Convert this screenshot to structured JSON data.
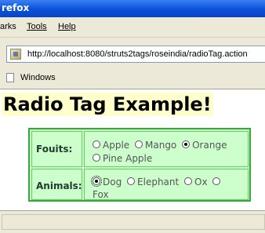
{
  "window": {
    "title": "refox"
  },
  "menubar": {
    "items": [
      {
        "label": "arks"
      },
      {
        "label": "Tools",
        "underline": "T"
      },
      {
        "label": "Help",
        "underline": "H"
      }
    ]
  },
  "address": {
    "url": "http://localhost:8080/struts2tags/roseindia/radioTag.action"
  },
  "bookmarks": {
    "items": [
      {
        "label": "Windows"
      }
    ]
  },
  "page": {
    "heading": "Radio Tag Example!",
    "fruits": {
      "label": "Fouits:",
      "options": [
        "Apple",
        "Mango",
        "Orange",
        "Pine Apple"
      ],
      "selected": "Orange"
    },
    "animals": {
      "label": "Animals:",
      "options": [
        "Dog",
        "Elephant",
        "Ox",
        "Fox"
      ],
      "selected": "Dog"
    }
  }
}
